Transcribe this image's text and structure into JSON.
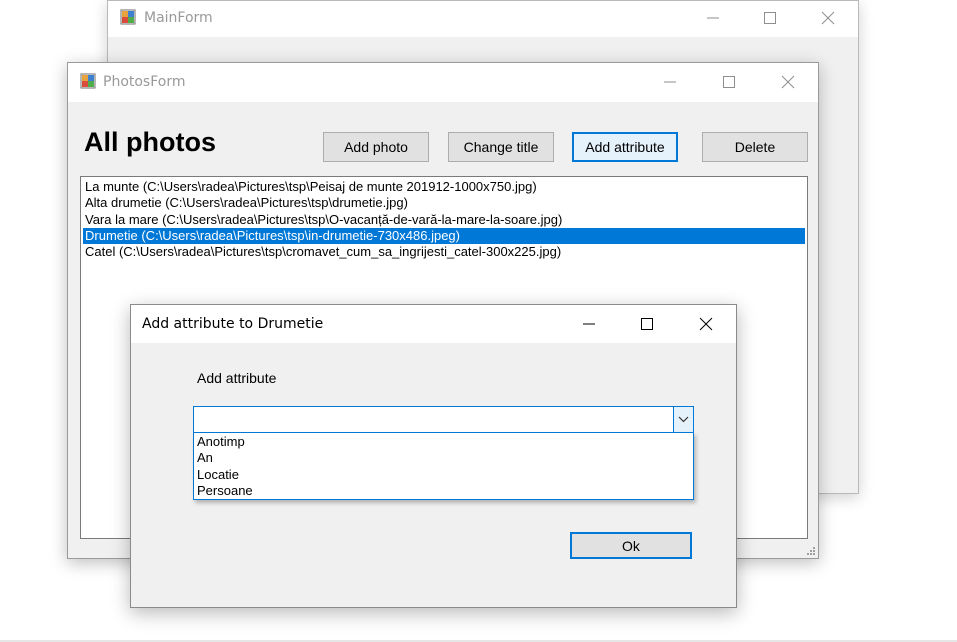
{
  "main_form": {
    "title": "MainForm"
  },
  "photos_form": {
    "title": "PhotosForm",
    "heading": "All photos",
    "buttons": {
      "add_photo": "Add photo",
      "change_title": "Change title",
      "add_attribute": "Add attribute",
      "delete": "Delete"
    },
    "photos": [
      "La munte (C:\\Users\\radea\\Pictures\\tsp\\Peisaj de munte 201912-1000x750.jpg)",
      "Alta drumetie (C:\\Users\\radea\\Pictures\\tsp\\drumetie.jpg)",
      "Vara la mare (C:\\Users\\radea\\Pictures\\tsp\\O-vacanță-de-vară-la-mare-la-soare.jpg)",
      "Drumetie (C:\\Users\\radea\\Pictures\\tsp\\in-drumetie-730x486.jpeg)",
      "Catel (C:\\Users\\radea\\Pictures\\tsp\\cromavet_cum_sa_ingrijesti_catel-300x225.jpg)"
    ],
    "selected_index": 3
  },
  "dialog": {
    "title": "Add attribute to Drumetie",
    "label": "Add attribute",
    "combo_value": "",
    "options": [
      "Anotimp",
      "An",
      "Locatie",
      "Persoane"
    ],
    "ok_label": "Ok"
  },
  "colors": {
    "accent": "#0078d7",
    "selection": "#0078d7",
    "window_bg": "#f0f0f0"
  },
  "icons": {
    "app": "winforms-app-icon",
    "minimize": "minimize-icon",
    "maximize": "maximize-icon",
    "close": "close-icon",
    "dropdown": "chevron-down-icon",
    "grip": "resize-grip-icon"
  }
}
